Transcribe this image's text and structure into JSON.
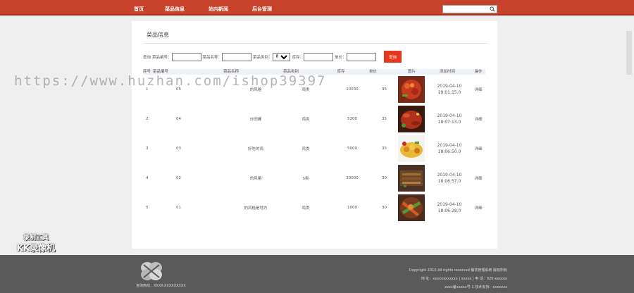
{
  "nav": {
    "items": [
      {
        "label": "首页"
      },
      {
        "label": "菜品信息"
      },
      {
        "label": "站内新闻"
      },
      {
        "label": "后台管理"
      }
    ]
  },
  "search": {
    "value": "",
    "placeholder": ""
  },
  "page": {
    "title": "菜品信息"
  },
  "filter": {
    "prefix": "查询",
    "code_label": "菜品编号：",
    "name_label": "菜品名称：",
    "category_label": "菜品类别：",
    "category_selected": "所有",
    "stock_label": "库存：",
    "price_label": "单价：",
    "query_button": "查询"
  },
  "table": {
    "headers": {
      "seq": "序号",
      "code": "菜品编号",
      "name": "菜品名称",
      "category": "菜品类别",
      "stock": "库存",
      "price": "单价",
      "image": "图片",
      "time": "添加时间",
      "op": "操作"
    },
    "rows": [
      {
        "seq": "1",
        "code": "05",
        "name": "的风格",
        "category": "鸡类",
        "stock": "10030",
        "price": "35",
        "date": "2019-04-10",
        "time": "19:01:15.0",
        "op": "详细",
        "img": "red-dish"
      },
      {
        "seq": "2",
        "code": "04",
        "name": "炒田螺",
        "category": "鸡类",
        "stock": "5300",
        "price": "35",
        "date": "2019-04-10",
        "time": "18:07:13.0",
        "op": "详细",
        "img": "crayfish-dish"
      },
      {
        "seq": "3",
        "code": "03",
        "name": "好吃的鸡",
        "category": "鸡类",
        "stock": "5000",
        "price": "35",
        "date": "2019-04-10",
        "time": "18:06:50.0",
        "op": "详细",
        "img": "fried-dish"
      },
      {
        "seq": "4",
        "code": "02",
        "name": "的风格",
        "category": "S类",
        "stock": "30000",
        "price": "30",
        "date": "2019-04-10",
        "time": "18:06:57.0",
        "op": "详细",
        "img": "skewer-dish"
      },
      {
        "seq": "5",
        "code": "01",
        "name": "的风格是地方",
        "category": "鸡类",
        "stock": "1000",
        "price": "30",
        "date": "2019-04-10",
        "time": "18:06:28.0",
        "op": "详细",
        "img": "vegetable-dish"
      }
    ]
  },
  "footer": {
    "phone": "咨询热线：XXXX-XXXXXXXXX",
    "copyright": "Copyright 2010 All rights reserved 餐饮管理系统 版权所有",
    "address": "地 址：xxxxxxxxxxxx | xxxxx | 电 话：025-xxxxxx",
    "record": "xxxx备xxxxx号-1 技术支持：xxxxxxx"
  },
  "watermark": {
    "text": "https://www.huzhan.com/ishop39397"
  },
  "recorder_badge": {
    "line1": "录制工具",
    "line2": "KK录像机"
  },
  "colors": {
    "topbar": "#c8412a",
    "button": "#e8371f",
    "footer": "#5a5a5a"
  }
}
